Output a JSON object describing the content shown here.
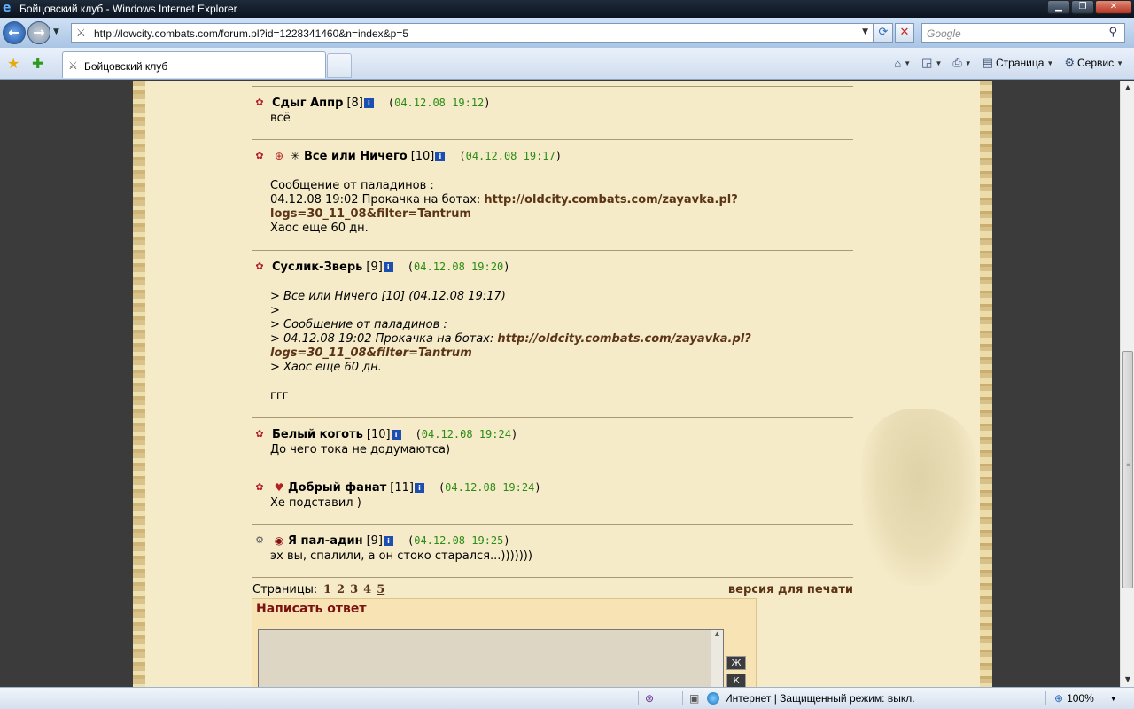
{
  "window": {
    "title": "Бойцовский клуб - Windows Internet Explorer"
  },
  "address": {
    "url": "http://lowcity.combats.com/forum.pl?id=1228341460&n=index&p=5"
  },
  "search": {
    "placeholder": "Google"
  },
  "tab": {
    "label": "Бойцовский клуб"
  },
  "commands": {
    "page": "Страница",
    "tools": "Сервис"
  },
  "posts": [
    {
      "nick": "Сдыг Аппр",
      "level": "[8]",
      "date": "04.12.08 19:12",
      "lines": [
        "всё"
      ]
    },
    {
      "nick": "Все или Ничего",
      "level": "[10]",
      "date": "04.12.08 19:17",
      "text1": "Сообщение от паладинов :",
      "text2": "04.12.08 19:02 Прокачка на ботах: ",
      "link1": "http://oldcity.combats.com/zayavka.pl?",
      "link2": "logs=30_11_08&filter=Tantrum",
      "text3": "Хаос еще 60 дн."
    },
    {
      "nick": "Суслик-Зверь",
      "level": "[9]",
      "date": "04.12.08 19:20",
      "q1": "> Все или Ничего [10]   (04.12.08 19:17)",
      "q2": ">",
      "q3": "> Сообщение от паладинов :",
      "q4": "> 04.12.08 19:02 Прокачка на ботах: ",
      "link1": "http://oldcity.combats.com/zayavka.pl?",
      "link2": "logs=30_11_08&filter=Tantrum",
      "q5": "> Хаос еще 60 дн.",
      "reply": "ггг"
    },
    {
      "nick": "Белый коготь",
      "level": "[10]",
      "date": "04.12.08 19:24",
      "lines": [
        "До чего тока не додумаютса)"
      ]
    },
    {
      "nick": "Добрый фанат",
      "level": "[11]",
      "date": "04.12.08 19:24",
      "lines": [
        "Хе подставил )"
      ]
    },
    {
      "nick": "Я пал-адин",
      "level": "[9]",
      "date": "04.12.08 19:25",
      "lines": [
        "эх вы, спалили, а он стоко старался...)))))))"
      ]
    }
  ],
  "pagination": {
    "label": "Страницы:",
    "pages": [
      "1",
      "2",
      "3",
      "4",
      "5"
    ],
    "print": "версия для печати"
  },
  "reply_form": {
    "title": "Написать ответ",
    "bold_btn": "Ж",
    "italic_btn": "К"
  },
  "status": {
    "zone": "Интернет | Защищенный режим: выкл.",
    "zoom": "100%"
  },
  "colors": {
    "parchment": "#f5ebc8",
    "date_green": "#2b8c14",
    "link_brown": "#5b3416",
    "reply_title": "#7a1212"
  }
}
